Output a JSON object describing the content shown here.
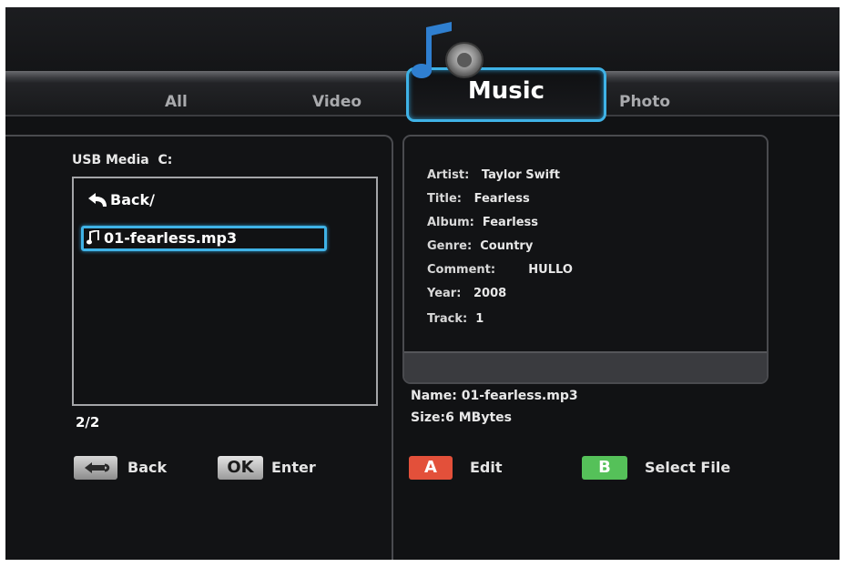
{
  "tabs": {
    "all": "All",
    "video": "Video",
    "music": "Music",
    "photo": "Photo"
  },
  "source": {
    "device": "USB Media",
    "drive": "C:"
  },
  "file_list": {
    "back_entry": "Back/",
    "selected_file": "01-fearless.mp3",
    "page": "2/2"
  },
  "metadata": [
    {
      "key": "Artist:",
      "value": "Taylor Swift"
    },
    {
      "key": "Title:",
      "value": "Fearless"
    },
    {
      "key": "Album:",
      "value": "Fearless"
    },
    {
      "key": "Genre:",
      "value": "Country"
    },
    {
      "key": "Comment:",
      "value": "HULLO"
    },
    {
      "key": "Year:",
      "value": "2008"
    },
    {
      "key": "Track:",
      "value": "1"
    }
  ],
  "file_info": {
    "name_label": "Name:",
    "name_value": "01-fearless.mp3",
    "size_label": "Size:",
    "size_value": "6 MBytes"
  },
  "hints": {
    "back_label": "Back",
    "ok_icon": "OK",
    "enter_label": "Enter",
    "a_icon": "A",
    "edit_label": "Edit",
    "b_icon": "B",
    "select_label": "Select File"
  },
  "colors": {
    "highlight": "#3fb2e6",
    "a_button": "#e3503a",
    "b_button": "#55c159"
  }
}
